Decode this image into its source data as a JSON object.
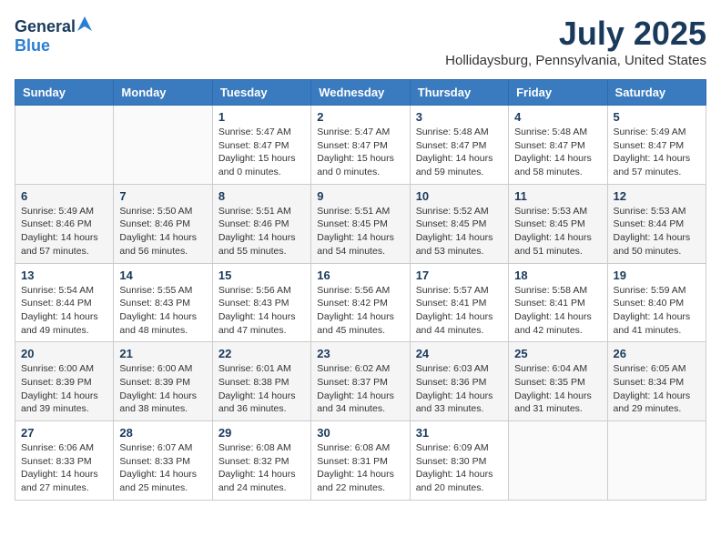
{
  "header": {
    "logo": {
      "general": "General",
      "blue": "Blue"
    },
    "title": "July 2025",
    "location": "Hollidaysburg, Pennsylvania, United States"
  },
  "weekdays": [
    "Sunday",
    "Monday",
    "Tuesday",
    "Wednesday",
    "Thursday",
    "Friday",
    "Saturday"
  ],
  "weeks": [
    [
      {
        "day": "",
        "info": ""
      },
      {
        "day": "",
        "info": ""
      },
      {
        "day": "1",
        "info": "Sunrise: 5:47 AM\nSunset: 8:47 PM\nDaylight: 15 hours and 0 minutes."
      },
      {
        "day": "2",
        "info": "Sunrise: 5:47 AM\nSunset: 8:47 PM\nDaylight: 15 hours and 0 minutes."
      },
      {
        "day": "3",
        "info": "Sunrise: 5:48 AM\nSunset: 8:47 PM\nDaylight: 14 hours and 59 minutes."
      },
      {
        "day": "4",
        "info": "Sunrise: 5:48 AM\nSunset: 8:47 PM\nDaylight: 14 hours and 58 minutes."
      },
      {
        "day": "5",
        "info": "Sunrise: 5:49 AM\nSunset: 8:47 PM\nDaylight: 14 hours and 57 minutes."
      }
    ],
    [
      {
        "day": "6",
        "info": "Sunrise: 5:49 AM\nSunset: 8:46 PM\nDaylight: 14 hours and 57 minutes."
      },
      {
        "day": "7",
        "info": "Sunrise: 5:50 AM\nSunset: 8:46 PM\nDaylight: 14 hours and 56 minutes."
      },
      {
        "day": "8",
        "info": "Sunrise: 5:51 AM\nSunset: 8:46 PM\nDaylight: 14 hours and 55 minutes."
      },
      {
        "day": "9",
        "info": "Sunrise: 5:51 AM\nSunset: 8:45 PM\nDaylight: 14 hours and 54 minutes."
      },
      {
        "day": "10",
        "info": "Sunrise: 5:52 AM\nSunset: 8:45 PM\nDaylight: 14 hours and 53 minutes."
      },
      {
        "day": "11",
        "info": "Sunrise: 5:53 AM\nSunset: 8:45 PM\nDaylight: 14 hours and 51 minutes."
      },
      {
        "day": "12",
        "info": "Sunrise: 5:53 AM\nSunset: 8:44 PM\nDaylight: 14 hours and 50 minutes."
      }
    ],
    [
      {
        "day": "13",
        "info": "Sunrise: 5:54 AM\nSunset: 8:44 PM\nDaylight: 14 hours and 49 minutes."
      },
      {
        "day": "14",
        "info": "Sunrise: 5:55 AM\nSunset: 8:43 PM\nDaylight: 14 hours and 48 minutes."
      },
      {
        "day": "15",
        "info": "Sunrise: 5:56 AM\nSunset: 8:43 PM\nDaylight: 14 hours and 47 minutes."
      },
      {
        "day": "16",
        "info": "Sunrise: 5:56 AM\nSunset: 8:42 PM\nDaylight: 14 hours and 45 minutes."
      },
      {
        "day": "17",
        "info": "Sunrise: 5:57 AM\nSunset: 8:41 PM\nDaylight: 14 hours and 44 minutes."
      },
      {
        "day": "18",
        "info": "Sunrise: 5:58 AM\nSunset: 8:41 PM\nDaylight: 14 hours and 42 minutes."
      },
      {
        "day": "19",
        "info": "Sunrise: 5:59 AM\nSunset: 8:40 PM\nDaylight: 14 hours and 41 minutes."
      }
    ],
    [
      {
        "day": "20",
        "info": "Sunrise: 6:00 AM\nSunset: 8:39 PM\nDaylight: 14 hours and 39 minutes."
      },
      {
        "day": "21",
        "info": "Sunrise: 6:00 AM\nSunset: 8:39 PM\nDaylight: 14 hours and 38 minutes."
      },
      {
        "day": "22",
        "info": "Sunrise: 6:01 AM\nSunset: 8:38 PM\nDaylight: 14 hours and 36 minutes."
      },
      {
        "day": "23",
        "info": "Sunrise: 6:02 AM\nSunset: 8:37 PM\nDaylight: 14 hours and 34 minutes."
      },
      {
        "day": "24",
        "info": "Sunrise: 6:03 AM\nSunset: 8:36 PM\nDaylight: 14 hours and 33 minutes."
      },
      {
        "day": "25",
        "info": "Sunrise: 6:04 AM\nSunset: 8:35 PM\nDaylight: 14 hours and 31 minutes."
      },
      {
        "day": "26",
        "info": "Sunrise: 6:05 AM\nSunset: 8:34 PM\nDaylight: 14 hours and 29 minutes."
      }
    ],
    [
      {
        "day": "27",
        "info": "Sunrise: 6:06 AM\nSunset: 8:33 PM\nDaylight: 14 hours and 27 minutes."
      },
      {
        "day": "28",
        "info": "Sunrise: 6:07 AM\nSunset: 8:33 PM\nDaylight: 14 hours and 25 minutes."
      },
      {
        "day": "29",
        "info": "Sunrise: 6:08 AM\nSunset: 8:32 PM\nDaylight: 14 hours and 24 minutes."
      },
      {
        "day": "30",
        "info": "Sunrise: 6:08 AM\nSunset: 8:31 PM\nDaylight: 14 hours and 22 minutes."
      },
      {
        "day": "31",
        "info": "Sunrise: 6:09 AM\nSunset: 8:30 PM\nDaylight: 14 hours and 20 minutes."
      },
      {
        "day": "",
        "info": ""
      },
      {
        "day": "",
        "info": ""
      }
    ]
  ]
}
